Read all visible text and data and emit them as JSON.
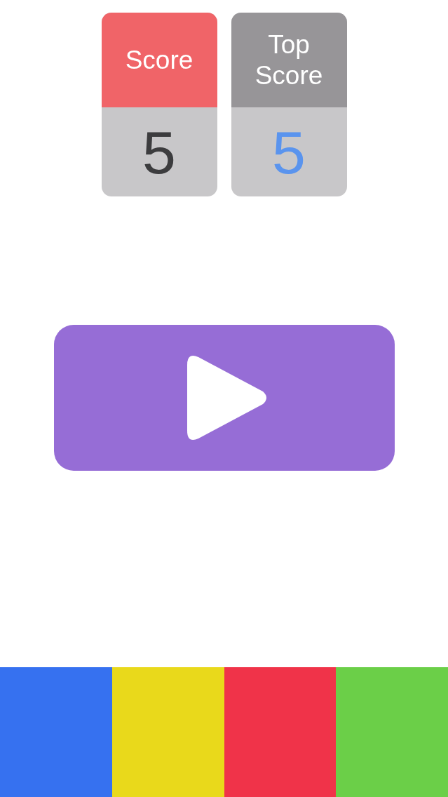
{
  "score_cards": [
    {
      "kind": "score",
      "label": "Score",
      "value": "5"
    },
    {
      "kind": "top_score",
      "label": "Top Score",
      "value": "5"
    }
  ],
  "color_pads": [
    {
      "color": "#3671f0"
    },
    {
      "color": "#e9d91b"
    },
    {
      "color": "#f03349"
    },
    {
      "color": "#6bcf48"
    }
  ]
}
